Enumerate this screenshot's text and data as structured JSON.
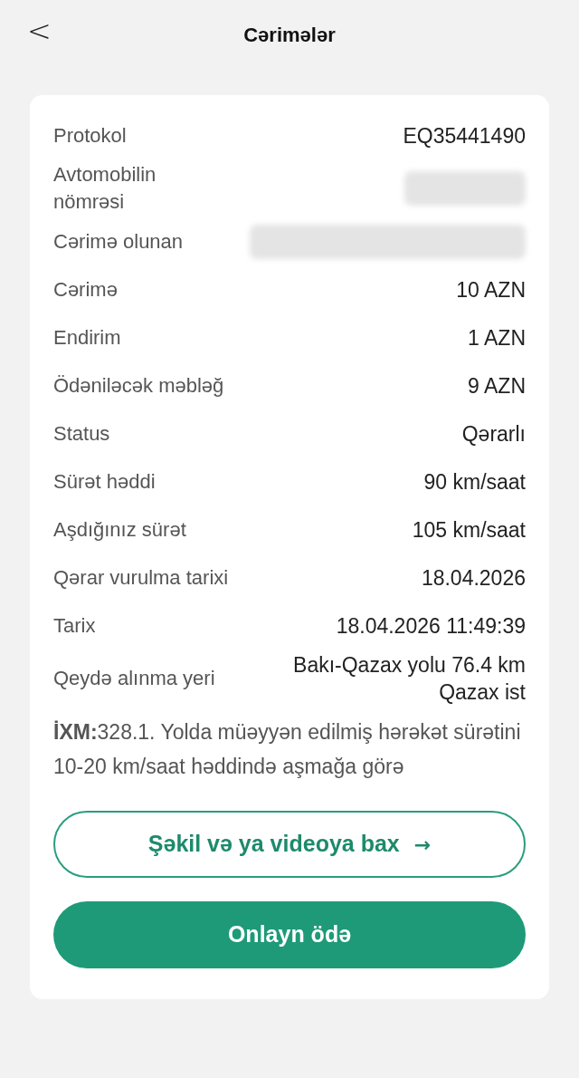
{
  "header": {
    "back": "<",
    "title": "Cərimələr"
  },
  "rows": [
    {
      "label": "Protokol",
      "kind": "text",
      "value": "EQ35441490"
    },
    {
      "label": "Avtomobilin nömrəsi",
      "kind": "plate"
    },
    {
      "label": "Cərimə olunan",
      "kind": "name"
    },
    {
      "label": "Cərimə",
      "kind": "text",
      "value": "10 AZN"
    },
    {
      "label": "Endirim",
      "kind": "text",
      "value": "1 AZN"
    },
    {
      "label": "Ödəniləcək məbləğ",
      "kind": "text",
      "value": "9 AZN"
    },
    {
      "label": "Status",
      "kind": "text",
      "value": "Qərarlı"
    },
    {
      "label": "Sürət həddi",
      "kind": "text",
      "value": "90 km/saat"
    },
    {
      "label": "Aşdığınız sürət",
      "kind": "text",
      "value": "105 km/saat"
    },
    {
      "label": "Qərar vurulma tarixi",
      "kind": "text",
      "value": "18.04.2026"
    },
    {
      "label": "Tarix",
      "kind": "text",
      "value": "18.04.2026 11:49:39"
    },
    {
      "label": "Qeydə alınma yeri",
      "kind": "text",
      "value": "Bakı-Qazax yolu 76.4 km Qazax ist"
    }
  ],
  "description": "**İXM:**328.1. Yolda müəyyən edilmiş hərəkət sürətini 10-20 km/saat həddində aşmağa görə",
  "buttons": [
    {
      "kind": "outline",
      "label": "Şəkil və ya videoya bax",
      "arrow": "→"
    },
    {
      "kind": "filled",
      "label": "Onlayn ödə"
    }
  ]
}
